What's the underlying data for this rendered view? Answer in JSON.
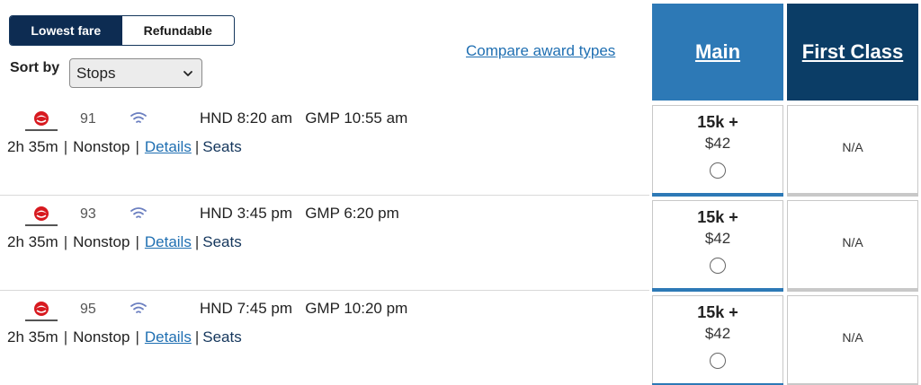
{
  "fare_toggle": {
    "lowest_label": "Lowest fare",
    "refundable_label": "Refundable"
  },
  "sort": {
    "label": "Sort by",
    "selected": "Stops"
  },
  "compare_link": "Compare award types",
  "columns": {
    "main": "Main",
    "first": "First Class"
  },
  "colors": {
    "main": "#2d79b6",
    "first": "#0b3d66",
    "toggle_active": "#0d2c52",
    "link": "#1f6fb2"
  },
  "airline_icon": "japan-airlines-logo",
  "flights": [
    {
      "number": "91",
      "depart_airport": "HND",
      "depart_time": "8:20 am",
      "arrive_airport": "GMP",
      "arrive_time": "10:55 am",
      "duration": "2h 35m",
      "stops": "Nonstop",
      "details_label": "Details",
      "seats_label": "Seats",
      "main_miles": "15k +",
      "main_tax": "$42",
      "first_value": "N/A"
    },
    {
      "number": "93",
      "depart_airport": "HND",
      "depart_time": "3:45 pm",
      "arrive_airport": "GMP",
      "arrive_time": "6:20 pm",
      "duration": "2h 35m",
      "stops": "Nonstop",
      "details_label": "Details",
      "seats_label": "Seats",
      "main_miles": "15k +",
      "main_tax": "$42",
      "first_value": "N/A"
    },
    {
      "number": "95",
      "depart_airport": "HND",
      "depart_time": "7:45 pm",
      "arrive_airport": "GMP",
      "arrive_time": "10:20 pm",
      "duration": "2h 35m",
      "stops": "Nonstop",
      "details_label": "Details",
      "seats_label": "Seats",
      "main_miles": "15k +",
      "main_tax": "$42",
      "first_value": "N/A"
    }
  ]
}
